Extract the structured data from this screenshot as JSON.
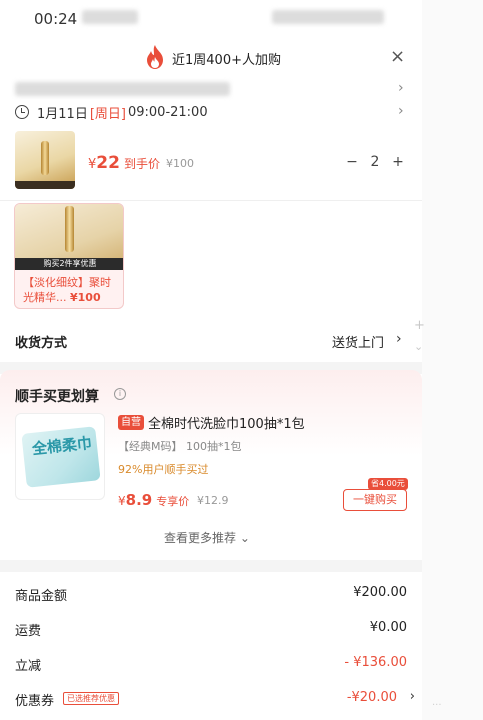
{
  "status_bar": {
    "time": "00:24"
  },
  "header": {
    "title": "近1周400+人加购",
    "close": "×"
  },
  "delivery_time": {
    "date": "1月11日",
    "weekday": "[周日]",
    "range": "09:00-21:00"
  },
  "main_product": {
    "price_symbol": "¥",
    "price": "22",
    "price_tag": "到手价",
    "original_price": "¥100",
    "quantity": "2",
    "minus": "−",
    "plus": "+"
  },
  "gift_item": {
    "band_text": "购买2件享优惠",
    "name": "【淡化细纹】聚时光精华...",
    "price": "¥100"
  },
  "delivery": {
    "label": "收货方式",
    "value": "送货上门"
  },
  "recommend": {
    "title": "顺手买更划算",
    "info": "i",
    "image_text": "全棉柔巾",
    "badge": "自营",
    "name": "全棉时代洗脸巾100抽*1包",
    "spec": "【经典M码】 100抽*1包",
    "stat": "92%用户顺手买过",
    "price_symbol": "¥",
    "price": "8.9",
    "price_tag": "专享价",
    "original_price": "¥12.9",
    "save_badge": "省4.00元",
    "buy_label": "一键购买",
    "more_label": "查看更多推荐 ⌄"
  },
  "summary": {
    "goods_label": "商品金额",
    "goods_value": "¥200.00",
    "shipping_label": "运费",
    "shipping_value": "¥0.00",
    "discount_label": "立减",
    "discount_value": "- ¥136.00",
    "coupon_label": "优惠券",
    "coupon_tag": "已选推荐优惠",
    "coupon_value": "-¥20.00"
  },
  "colors": {
    "accent": "#e94e3a",
    "gold": "#d98a2b",
    "bg_gray": "#f4f4f4"
  },
  "icons": [
    "flame-icon",
    "close-icon",
    "clock-icon",
    "chevron-right-icon",
    "info-icon"
  ]
}
